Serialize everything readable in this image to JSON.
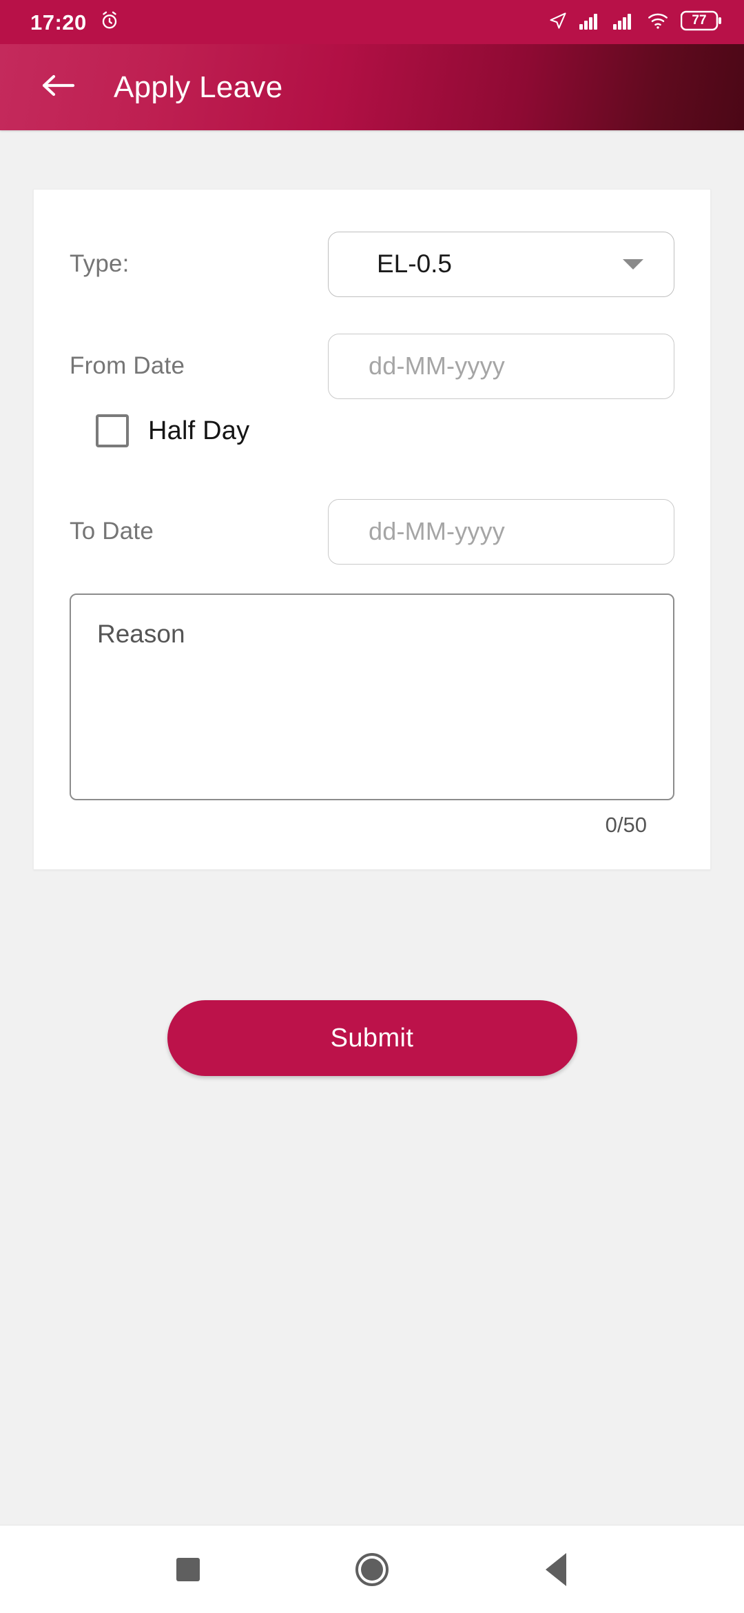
{
  "status_bar": {
    "time": "17:20",
    "alarm_icon": "alarm-clock-icon",
    "location_icon": "location-arrow-icon",
    "signal_icon_1": "cellular-signal-icon",
    "signal_icon_2": "cellular-signal-icon",
    "wifi_icon": "wifi-icon",
    "battery_level": "77",
    "background_color": "#B81148"
  },
  "app_bar": {
    "back_icon": "arrow-left-icon",
    "title": "Apply Leave",
    "gradient_from": "#C42A5C",
    "gradient_to": "#4B0716"
  },
  "form": {
    "type": {
      "label": "Type:",
      "selected_value": "EL-0.5",
      "caret_icon": "chevron-down-icon"
    },
    "from_date": {
      "label": "From Date",
      "value": "",
      "placeholder": "dd-MM-yyyy"
    },
    "half_day": {
      "label": "Half Day",
      "checked": false
    },
    "to_date": {
      "label": "To Date",
      "value": "",
      "placeholder": "dd-MM-yyyy"
    },
    "reason": {
      "value": "",
      "placeholder": "Reason",
      "char_counter": "0/50",
      "max_length": 50
    }
  },
  "actions": {
    "submit_label": "Submit",
    "submit_color": "#BC124A"
  },
  "nav_bar": {
    "recents_icon": "square-recents-icon",
    "home_icon": "circle-home-icon",
    "back_icon": "triangle-back-icon"
  }
}
